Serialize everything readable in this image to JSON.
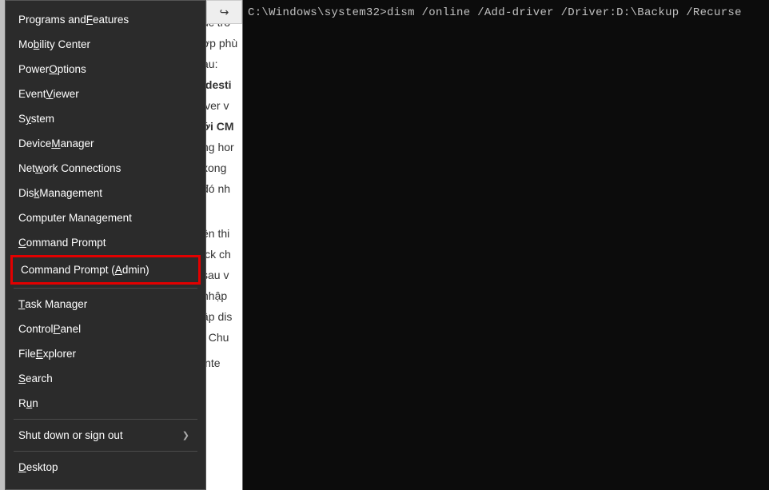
{
  "terminal": {
    "prompt": "C:\\Windows\\system32>",
    "command": "dism /online /Add-driver /Driver:D:\\Backup /Recurse"
  },
  "winx": {
    "items": [
      {
        "pre": "Programs and ",
        "u": "F",
        "post": "eatures"
      },
      {
        "pre": "Mo",
        "u": "b",
        "post": "ility Center"
      },
      {
        "pre": "Power ",
        "u": "O",
        "post": "ptions"
      },
      {
        "pre": "Event ",
        "u": "V",
        "post": "iewer"
      },
      {
        "pre": "S",
        "u": "y",
        "post": "stem"
      },
      {
        "pre": "Device ",
        "u": "M",
        "post": "anager"
      },
      {
        "pre": "Net",
        "u": "w",
        "post": "ork Connections"
      },
      {
        "pre": "Dis",
        "u": "k",
        "post": " Management"
      },
      {
        "pre": "Computer Mana",
        "u": "g",
        "post": "ement"
      },
      {
        "pre": "",
        "u": "C",
        "post": "ommand Prompt"
      },
      {
        "pre": "Command Prompt (",
        "u": "A",
        "post": "dmin)"
      },
      {
        "pre": "",
        "u": "T",
        "post": "ask Manager"
      },
      {
        "pre": "Control ",
        "u": "P",
        "post": "anel"
      },
      {
        "pre": "File ",
        "u": "E",
        "post": "xplorer"
      },
      {
        "pre": "",
        "u": "S",
        "post": "earch"
      },
      {
        "pre": "R",
        "u": "u",
        "post": "n"
      }
    ],
    "submenu": {
      "pre": "Sh",
      "u": "u",
      "post": "t down or sign out"
    },
    "desktop": {
      "pre": "",
      "u": "D",
      "post": "esktop"
    }
  },
  "bg": {
    "lines": [
      "",
      "ục trơ",
      "",
      "ợp phù",
      "",
      "au:",
      "",
      "/desti",
      "",
      "iver v",
      "",
      "ới CM",
      "",
      "ng hor",
      "xong",
      "",
      "đó nh",
      "",
      "",
      "",
      "ện thi",
      "",
      "ick ch",
      "",
      "sau v",
      "",
      "nhập",
      "ập dis",
      "",
      ". Chu",
      "",
      "inte"
    ]
  },
  "top_arrow": "↪"
}
